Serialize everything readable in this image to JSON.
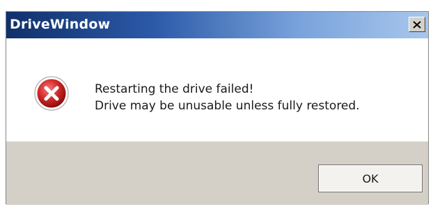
{
  "window": {
    "title": "DriveWindow"
  },
  "title_bar": {
    "close_icon": "close-icon"
  },
  "content": {
    "icon": "error-icon",
    "line1": "Restarting the drive failed!",
    "line2": "Drive may be unusable unless fully restored."
  },
  "footer": {
    "ok_label": "OK"
  },
  "colors": {
    "title_bar_dark": "#10306a",
    "title_bar_light": "#a8c6ec",
    "footer_bg": "#d4d0c8",
    "error_red": "#d42828"
  }
}
